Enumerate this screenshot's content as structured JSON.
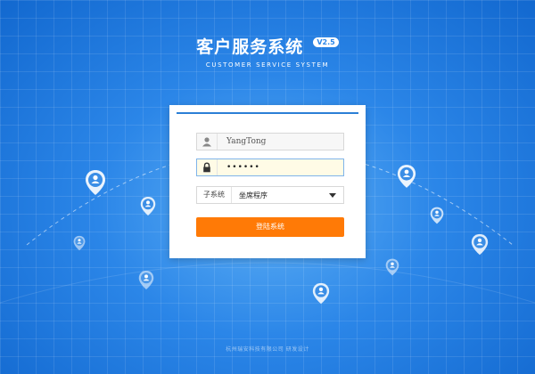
{
  "brand": {
    "title": "客户服务系统",
    "version": "V2.5",
    "subtitle": "CUSTOMER SERVICE SYSTEM"
  },
  "login_form": {
    "username_value": "YangTong",
    "password_value": "••••••",
    "subsystem_label": "子系统",
    "subsystem_selected": "坐席程序",
    "login_button": "登陆系统"
  },
  "icons": {
    "user": "user-icon",
    "lock": "lock-icon",
    "dropdown": "chevron-down-icon",
    "pin": "location-pin-icon"
  },
  "colors": {
    "accent": "#2b7fd6",
    "button": "#ff7a06",
    "background": "#2b86e8"
  },
  "footer": {
    "text": "杭州瑞安科技有限公司 研发设计"
  }
}
